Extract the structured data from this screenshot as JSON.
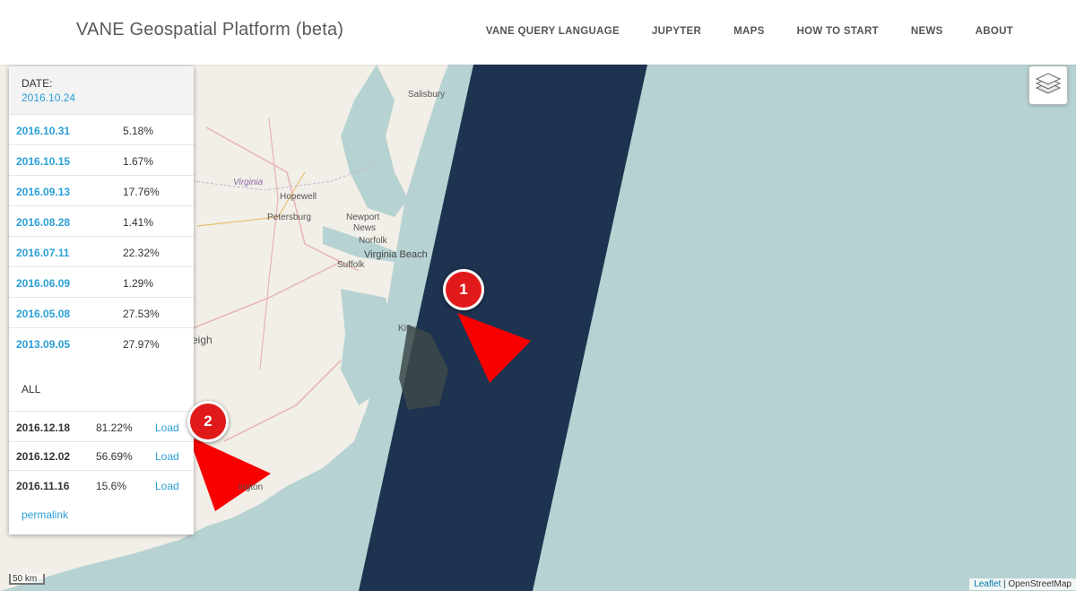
{
  "header": {
    "brand": "VANE Geospatial Platform (beta)",
    "nav": [
      "VANE QUERY LANGUAGE",
      "JUPYTER",
      "MAPS",
      "HOW TO START",
      "NEWS",
      "ABOUT"
    ]
  },
  "panel": {
    "date_label": "DATE:",
    "date_value": "2016.10.24",
    "dates": [
      {
        "date": "2016.10.31",
        "pct": "5.18%"
      },
      {
        "date": "2016.10.15",
        "pct": "1.67%"
      },
      {
        "date": "2016.09.13",
        "pct": "17.76%"
      },
      {
        "date": "2016.08.28",
        "pct": "1.41%"
      },
      {
        "date": "2016.07.11",
        "pct": "22.32%"
      },
      {
        "date": "2016.06.09",
        "pct": "1.29%"
      },
      {
        "date": "2016.05.08",
        "pct": "27.53%"
      },
      {
        "date": "2013.09.05",
        "pct": "27.97%"
      }
    ],
    "all_label": "ALL",
    "all_rows": [
      {
        "date": "2016.12.18",
        "pct": "81.22%",
        "load": "Load"
      },
      {
        "date": "2016.12.02",
        "pct": "56.69%",
        "load": "Load"
      },
      {
        "date": "2016.11.16",
        "pct": "15.6%",
        "load": "Load"
      }
    ],
    "permalink": "permalink"
  },
  "map": {
    "labels": [
      "Salisbury",
      "Virginia",
      "Hopewell",
      "Petersburg",
      "Newport",
      "News",
      "Norfolk",
      "Suffolk",
      "Virginia Beach",
      "Kitty",
      "eigh",
      "ington"
    ],
    "scale": "50 km",
    "attribution_leaflet": "Leaflet",
    "attribution_sep": " | ",
    "attribution_osm": "OpenStreetMap",
    "annotations": [
      "1",
      "2"
    ]
  },
  "colors": {
    "accent": "#2a9fd6",
    "water": "#b7d2d2",
    "land": "#f1efe7",
    "overlay": "#1d3350",
    "marker": "#e01a1a"
  }
}
